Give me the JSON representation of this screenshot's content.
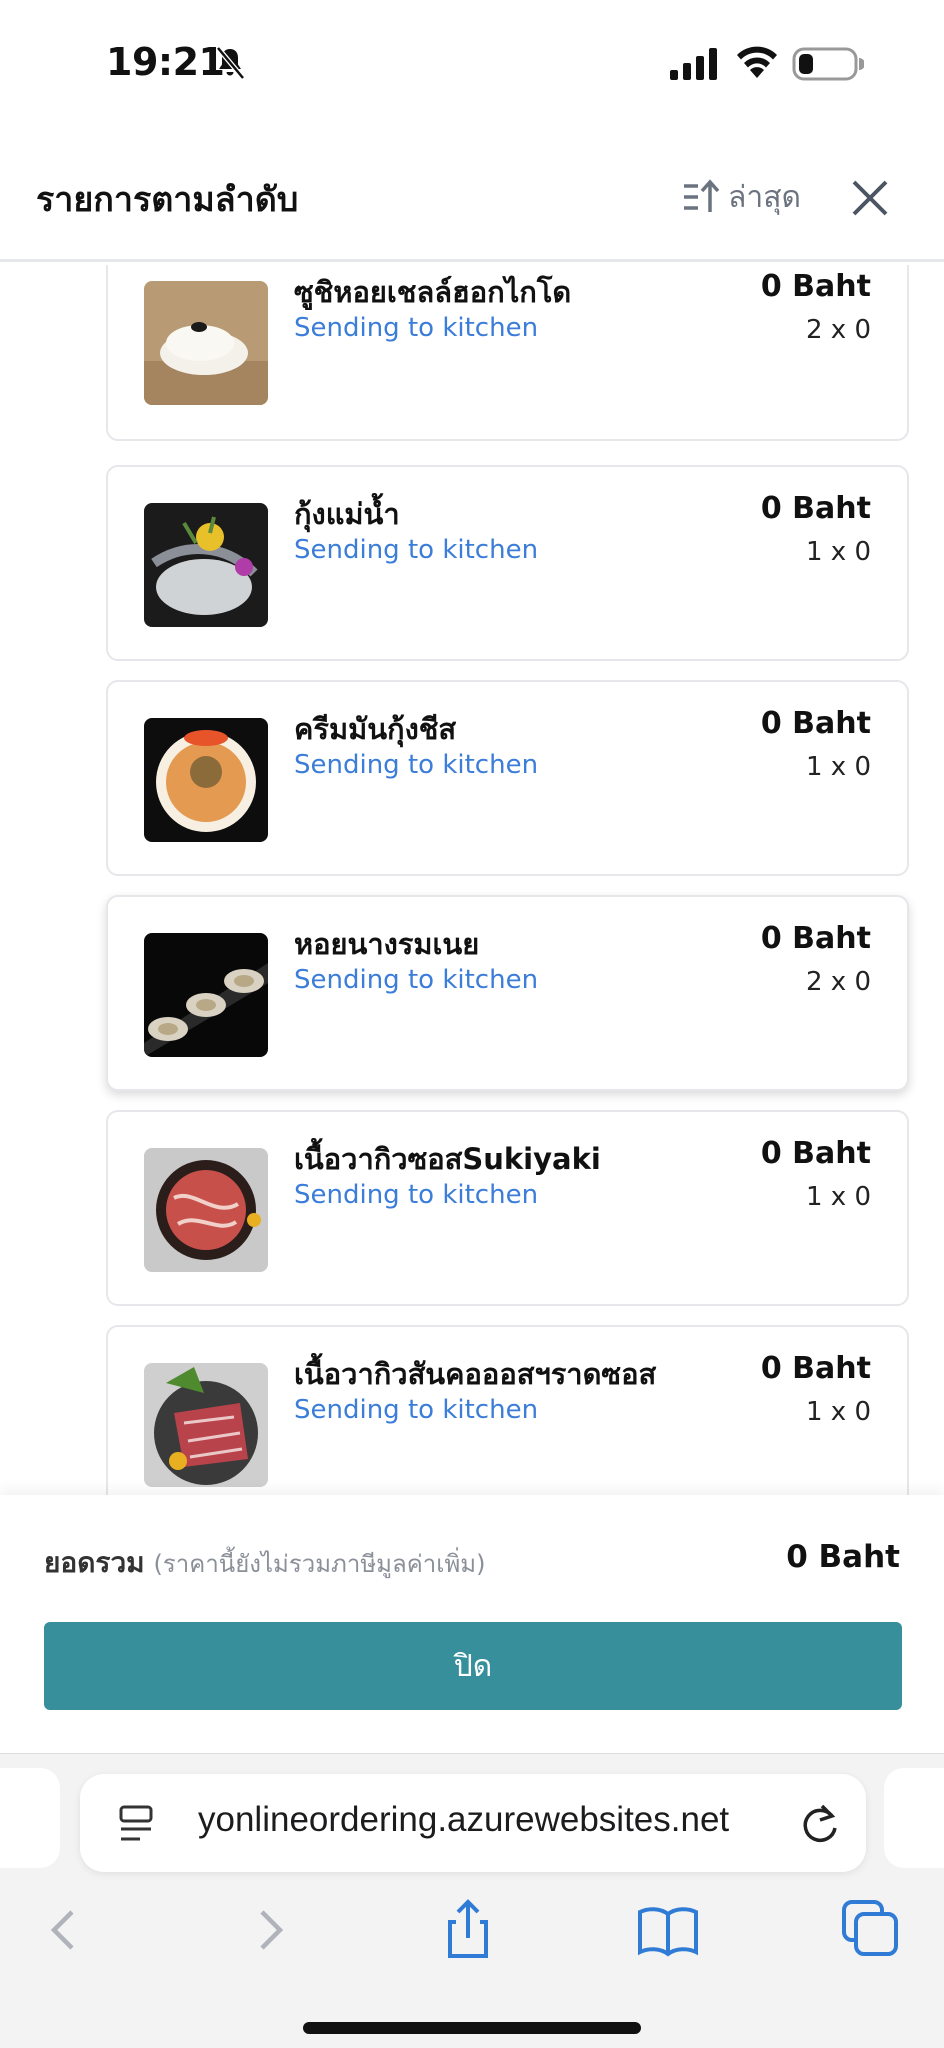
{
  "status_bar": {
    "time": "19:21"
  },
  "header": {
    "title": "รายการตามลำดับ",
    "sort_label": "ล่าสุด"
  },
  "items": [
    {
      "name": "ซูชิหอยเชลล์ฮอกไกโด",
      "status": "Sending to kitchen",
      "price": "0 Baht",
      "qty": "2 x 0"
    },
    {
      "name": "กุ้งแม่น้ำ",
      "status": "Sending to kitchen",
      "price": "0 Baht",
      "qty": "1 x 0"
    },
    {
      "name": "ครีมมันกุ้งชีส",
      "status": "Sending to kitchen",
      "price": "0 Baht",
      "qty": "1 x 0"
    },
    {
      "name": "หอยนางรมเนย",
      "status": "Sending to kitchen",
      "price": "0 Baht",
      "qty": "2 x 0"
    },
    {
      "name": "เนื้อวากิวซอสSukiyaki",
      "status": "Sending to kitchen",
      "price": "0 Baht",
      "qty": "1 x 0"
    },
    {
      "name": "เนื้อวากิวสันคอออสฯราดซอส",
      "status": "Sending to kitchen",
      "price": "0 Baht",
      "qty": "1 x 0"
    }
  ],
  "footer": {
    "total_label": "ยอดรวม",
    "total_note": "(ราคานี้ยังไม่รวมภาษีมูลค่าเพิ่ม)",
    "total_value": "0 Baht",
    "close_label": "ปิด"
  },
  "browser": {
    "url": "yonlineordering.azurewebsites.net"
  },
  "colors": {
    "accent": "#368f9b",
    "status_blue": "#3b7dd8",
    "muted": "#8a8f98"
  }
}
